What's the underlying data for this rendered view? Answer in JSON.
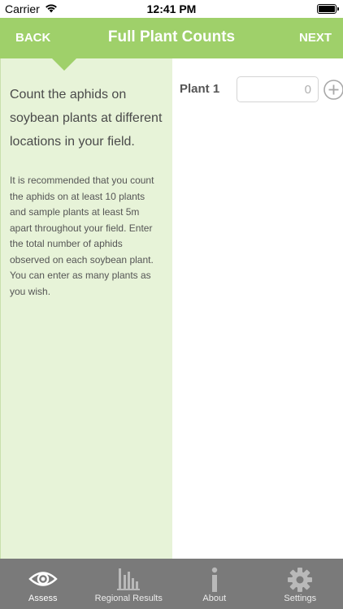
{
  "status_bar": {
    "carrier": "Carrier",
    "time": "12:41 PM"
  },
  "nav": {
    "back_label": "BACK",
    "title": "Full Plant Counts",
    "next_label": "NEXT"
  },
  "instructions": {
    "intro": "Count the aphids on soybean plants at different locations in your field.",
    "detail": "It is recommended that you count the aphids on at least 10 plants and sample plants at least 5m apart throughout your field. Enter the total number of aphids observed on each soybean plant. You can enter as many plants as you wish."
  },
  "plants": [
    {
      "label": "Plant 1",
      "value": "",
      "placeholder": "0"
    }
  ],
  "tabs": [
    {
      "label": "Assess",
      "icon": "eye-icon",
      "active": true
    },
    {
      "label": "Regional Results",
      "icon": "bar-chart-icon",
      "active": false
    },
    {
      "label": "About",
      "icon": "info-icon",
      "active": false
    },
    {
      "label": "Settings",
      "icon": "gear-icon",
      "active": false
    }
  ],
  "colors": {
    "nav_green": "#9fd06a",
    "panel_green": "#e7f3d8",
    "tab_bar": "#7a7a7a"
  }
}
